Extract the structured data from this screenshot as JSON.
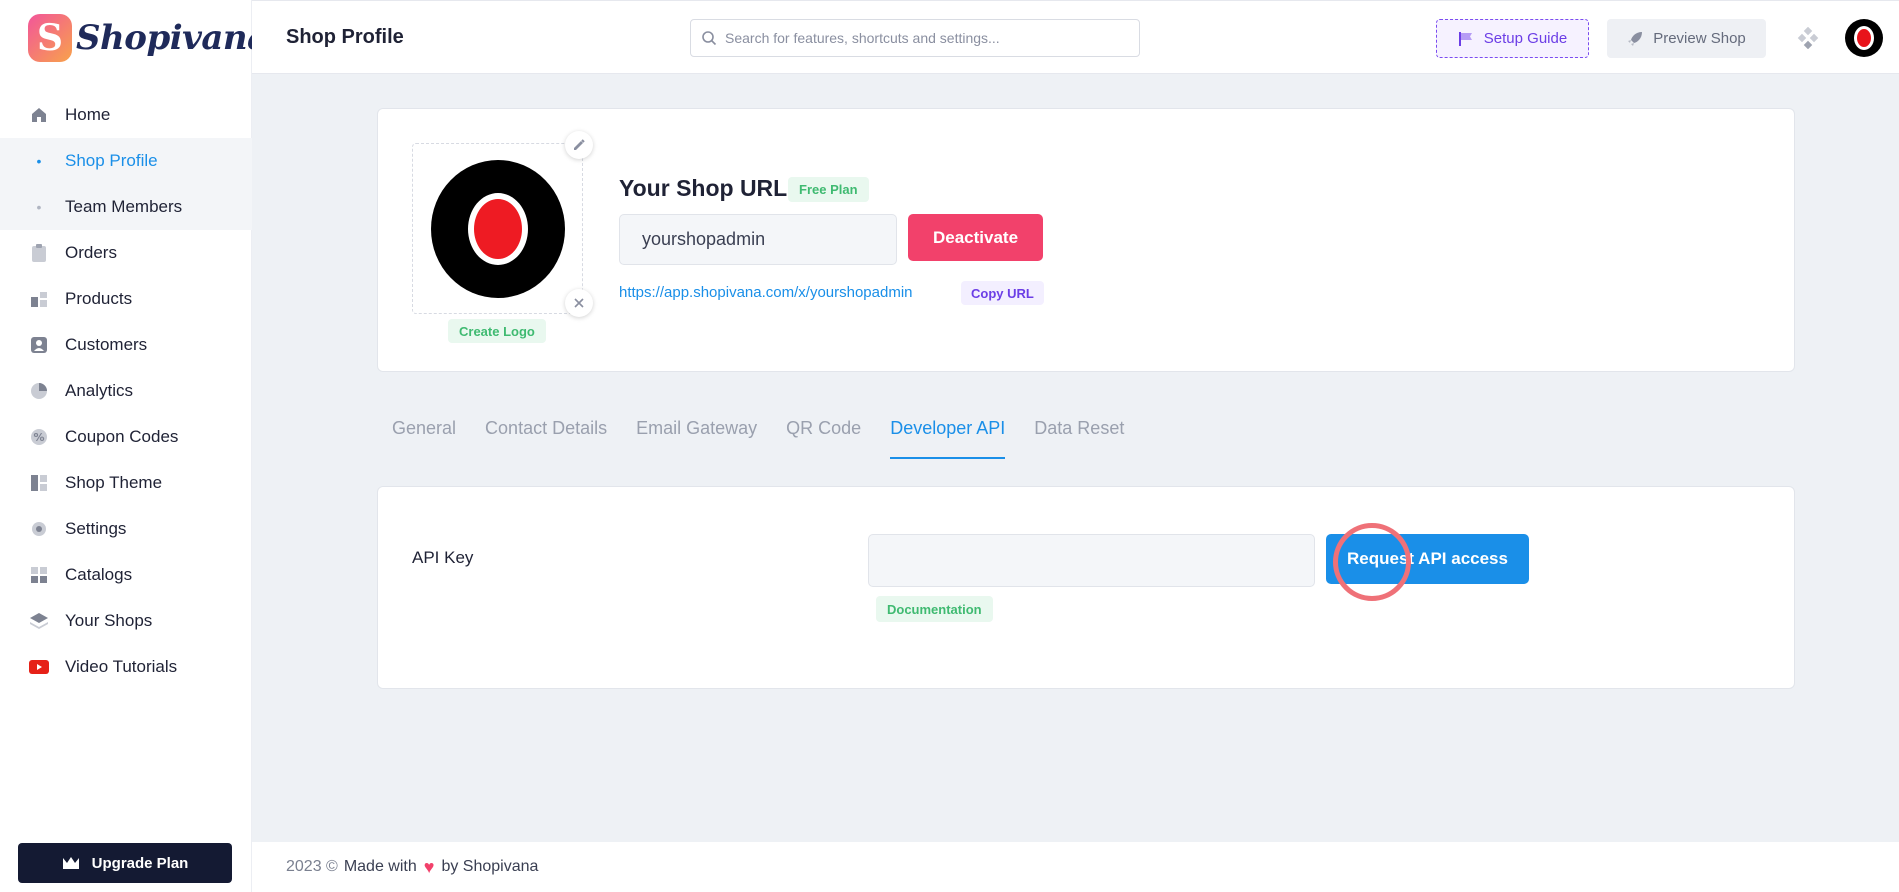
{
  "brand": {
    "logo_letter": "S",
    "name": "Shopivana"
  },
  "sidebar": {
    "items": [
      {
        "label": "Home",
        "icon": "home-icon"
      },
      {
        "label": "Shop Profile",
        "icon": "dot"
      },
      {
        "label": "Team Members",
        "icon": "dot"
      },
      {
        "label": "Orders",
        "icon": "clipboard-icon"
      },
      {
        "label": "Products",
        "icon": "products-icon"
      },
      {
        "label": "Customers",
        "icon": "customer-icon"
      },
      {
        "label": "Analytics",
        "icon": "pie-chart-icon"
      },
      {
        "label": "Coupon Codes",
        "icon": "percent-badge-icon"
      },
      {
        "label": "Shop Theme",
        "icon": "layout-icon"
      },
      {
        "label": "Settings",
        "icon": "gear-icon"
      },
      {
        "label": "Catalogs",
        "icon": "grid-icon"
      },
      {
        "label": "Your Shops",
        "icon": "layers-icon"
      },
      {
        "label": "Video Tutorials",
        "icon": "youtube-icon"
      }
    ],
    "active_item": "Shop Profile",
    "upgrade_label": "Upgrade Plan"
  },
  "header": {
    "title": "Shop Profile",
    "search_placeholder": "Search for features, shortcuts and settings...",
    "setup_guide_label": "Setup Guide",
    "preview_shop_label": "Preview Shop"
  },
  "profile": {
    "create_logo_label": "Create Logo",
    "shop_url_title": "Your Shop URL",
    "plan_badge": "Free Plan",
    "shop_handle": "yourshopadmin",
    "deactivate_label": "Deactivate",
    "shop_link": "https://app.shopivana.com/x/yourshopadmin",
    "copy_url_label": "Copy URL"
  },
  "tabs": [
    {
      "label": "General"
    },
    {
      "label": "Contact Details"
    },
    {
      "label": "Email Gateway"
    },
    {
      "label": "QR Code"
    },
    {
      "label": "Developer API"
    },
    {
      "label": "Data Reset"
    }
  ],
  "active_tab": "Developer API",
  "api": {
    "label": "API Key",
    "value": "",
    "request_label": "Request API access",
    "documentation_label": "Documentation"
  },
  "footer": {
    "year": "2023 ©",
    "made_with": "Made with",
    "by": "by Shopivana"
  },
  "colors": {
    "accent": "#1a8fe8",
    "danger": "#f2416b",
    "success": "#3fba71",
    "purple": "#6c3ee6",
    "dark": "#141a33"
  }
}
